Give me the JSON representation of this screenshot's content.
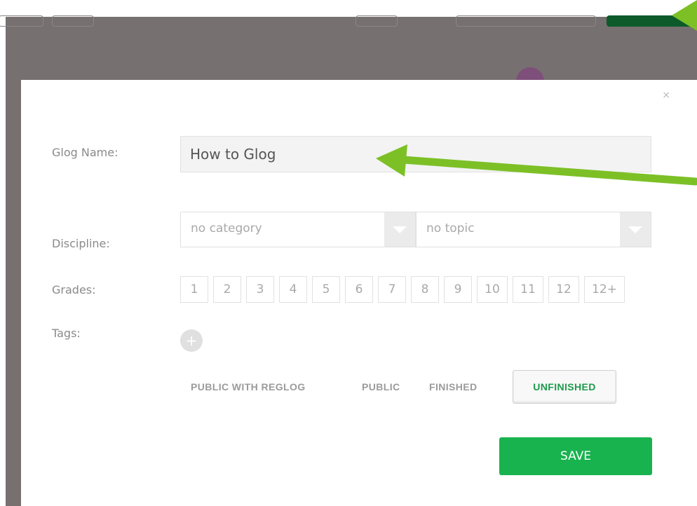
{
  "dialog": {
    "close_glyph": "×",
    "name_label": "Glog Name:",
    "name_value": "How to Glog",
    "discipline_label": "Discipline:",
    "category_value": "no category",
    "topic_value": "no topic",
    "grades_label": "Grades:",
    "grades": [
      "1",
      "2",
      "3",
      "4",
      "5",
      "6",
      "7",
      "8",
      "9",
      "10",
      "11",
      "12",
      "12+"
    ],
    "tags_label": "Tags:",
    "tag_add_glyph": "+",
    "visibility": {
      "public_reglog": "PUBLIC WITH REGLOG",
      "public": "PUBLIC",
      "finished": "FINISHED",
      "unfinished": "UNFINISHED",
      "selected": "unfinished"
    },
    "save_label": "SAVE"
  },
  "colors": {
    "accent_green": "#18b34f",
    "selected_text_green": "#1c9a4a",
    "annotation_arrow": "#7cc026",
    "overlay": "#767070"
  },
  "icons": {
    "close": "close-icon",
    "dropdown": "chevron-down-icon",
    "add_tag": "plus-icon"
  }
}
